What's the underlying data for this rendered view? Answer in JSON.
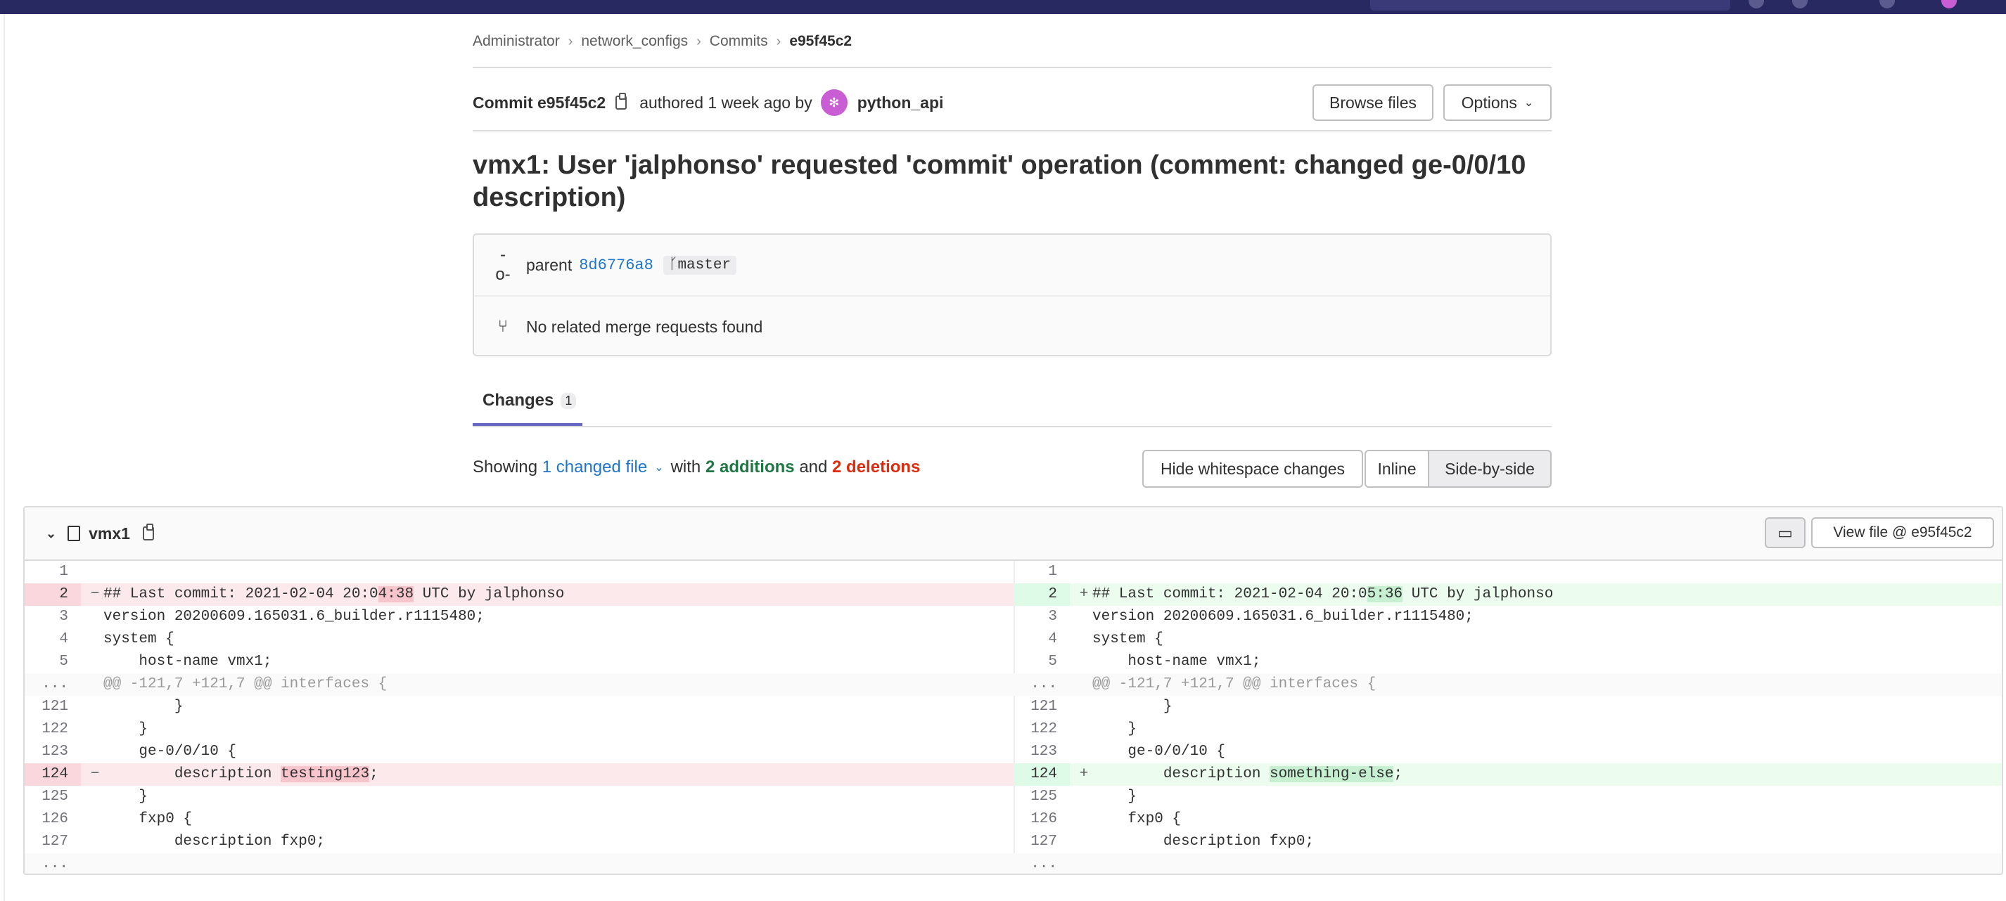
{
  "breadcrumb": [
    "Administrator",
    "network_configs",
    "Commits",
    "e95f45c2"
  ],
  "commit": {
    "label": "Commit",
    "sha": "e95f45c2",
    "authored_text": "authored 1 week ago by",
    "author": "python_api",
    "title": "vmx1: User 'jalphonso' requested 'commit' operation (comment: changed ge-0/0/10 description)",
    "parent_label": "parent",
    "parent_sha": "8d6776a8",
    "branch": "master",
    "merge_requests_text": "No related merge requests found"
  },
  "buttons": {
    "browse_files": "Browse files",
    "options": "Options",
    "hide_whitespace": "Hide whitespace changes",
    "inline": "Inline",
    "side_by_side": "Side-by-side",
    "view_file": "View file @ e95f45c2"
  },
  "tabs": {
    "changes_label": "Changes",
    "changes_count": "1"
  },
  "stats": {
    "showing": "Showing",
    "changed_file": "1 changed file",
    "with": "with",
    "additions": "2 additions",
    "and": "and",
    "deletions": "2 deletions"
  },
  "file": {
    "name": "vmx1"
  },
  "diff_left": [
    {
      "num": "1",
      "code": "",
      "type": "normal"
    },
    {
      "num": "2",
      "pre": "## Last commit: 2021-02-04 20:0",
      "hl": "4:38",
      "post": " UTC by jalphonso",
      "type": "del"
    },
    {
      "num": "3",
      "code": "version 20200609.165031.6_builder.r1115480;",
      "type": "normal"
    },
    {
      "num": "4",
      "code": "system {",
      "type": "normal"
    },
    {
      "num": "5",
      "code": "    host-name vmx1;",
      "type": "normal"
    },
    {
      "num": "...",
      "code": "@@ -121,7 +121,7 @@ interfaces {",
      "type": "hunk"
    },
    {
      "num": "121",
      "code": "        }",
      "type": "normal"
    },
    {
      "num": "122",
      "code": "    }",
      "type": "normal"
    },
    {
      "num": "123",
      "code": "    ge-0/0/10 {",
      "type": "normal"
    },
    {
      "num": "124",
      "pre": "        description ",
      "hl": "testing123",
      "post": ";",
      "type": "del"
    },
    {
      "num": "125",
      "code": "    }",
      "type": "normal"
    },
    {
      "num": "126",
      "code": "    fxp0 {",
      "type": "normal"
    },
    {
      "num": "127",
      "code": "        description fxp0;",
      "type": "normal"
    },
    {
      "num": "...",
      "code": "",
      "type": "hunk"
    }
  ],
  "diff_right": [
    {
      "num": "1",
      "code": "",
      "type": "normal"
    },
    {
      "num": "2",
      "pre": "## Last commit: 2021-02-04 20:0",
      "hl": "5:36",
      "post": " UTC by jalphonso",
      "type": "add"
    },
    {
      "num": "3",
      "code": "version 20200609.165031.6_builder.r1115480;",
      "type": "normal"
    },
    {
      "num": "4",
      "code": "system {",
      "type": "normal"
    },
    {
      "num": "5",
      "code": "    host-name vmx1;",
      "type": "normal"
    },
    {
      "num": "...",
      "code": "@@ -121,7 +121,7 @@ interfaces {",
      "type": "hunk"
    },
    {
      "num": "121",
      "code": "        }",
      "type": "normal"
    },
    {
      "num": "122",
      "code": "    }",
      "type": "normal"
    },
    {
      "num": "123",
      "code": "    ge-0/0/10 {",
      "type": "normal"
    },
    {
      "num": "124",
      "pre": "        description ",
      "hl": "something-else",
      "post": ";",
      "type": "add"
    },
    {
      "num": "125",
      "code": "    }",
      "type": "normal"
    },
    {
      "num": "126",
      "code": "    fxp0 {",
      "type": "normal"
    },
    {
      "num": "127",
      "code": "        description fxp0;",
      "type": "normal"
    },
    {
      "num": "...",
      "code": "",
      "type": "hunk"
    }
  ],
  "icons": {
    "commit_icon": "commit-icon",
    "merge_request_icon": "merge-request-icon",
    "copy_icon": "copy-icon",
    "file_icon": "file-icon",
    "comment_icon": "comment-icon",
    "collapse_icon": "chevron-down-icon"
  },
  "colors": {
    "topbar": "#292961",
    "link": "#1f75cb",
    "addition": "#217645",
    "deletion": "#dd2b0e",
    "tab_underline": "#6666c4"
  }
}
